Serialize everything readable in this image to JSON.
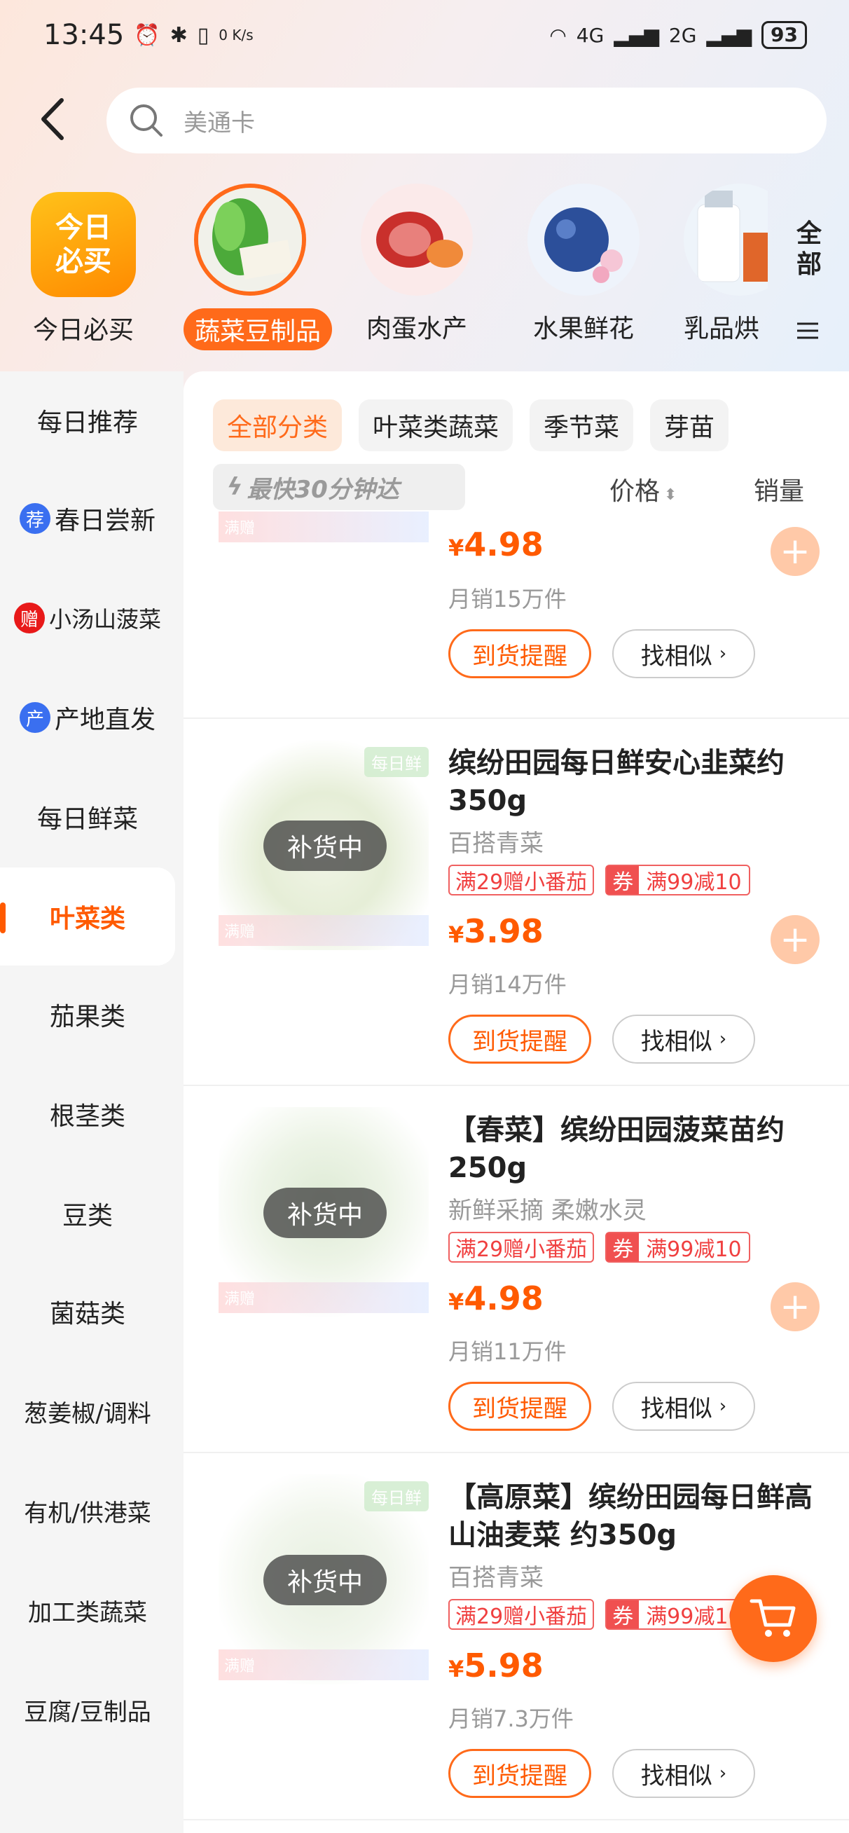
{
  "status_bar": {
    "time": "13:45",
    "net_speed": "0 K/s",
    "signal1": "4G",
    "signal2": "2G",
    "battery": "93"
  },
  "search": {
    "placeholder": "美通卡"
  },
  "top_categories": [
    {
      "label": "今日必买",
      "icon_text": "今日必买"
    },
    {
      "label": "蔬菜豆制品"
    },
    {
      "label": "肉蛋水产"
    },
    {
      "label": "水果鲜花"
    },
    {
      "label": "乳品烘"
    }
  ],
  "all_categories_label": "全部",
  "sidebar": {
    "items": [
      {
        "label": "每日推荐"
      },
      {
        "label": "春日尝新",
        "badge": "荐",
        "badge_color": "#3a6ff0"
      },
      {
        "label": "小汤山菠菜",
        "badge": "赠",
        "badge_color": "#e81919"
      },
      {
        "label": "产地直发",
        "badge": "产",
        "badge_color": "#3a6ff0"
      },
      {
        "label": "每日鲜菜"
      },
      {
        "label": "叶菜类"
      },
      {
        "label": "茄果类"
      },
      {
        "label": "根茎类"
      },
      {
        "label": "豆类"
      },
      {
        "label": "菌菇类"
      },
      {
        "label": "葱姜椒/调料"
      },
      {
        "label": "有机/供港菜"
      },
      {
        "label": "加工类蔬菜"
      },
      {
        "label": "豆腐/豆制品"
      }
    ]
  },
  "chips": [
    "全部分类",
    "叶菜类蔬菜",
    "季节菜",
    "芽苗"
  ],
  "sort": {
    "fast_label": "最快30分钟达",
    "price_label": "价格",
    "sales_label": "销量"
  },
  "products": [
    {
      "price": "4.98",
      "sales": "月销15万件",
      "remind": "到货提醒",
      "similar": "找相似",
      "gift_strip": "满赠"
    },
    {
      "name": "缤纷田园每日鲜安心韭菜约350g",
      "sub": "百搭青菜",
      "tag1": "满29赠小番茄",
      "coupon_mark": "券",
      "tag2": "满99减10",
      "price": "3.98",
      "sales": "月销14万件",
      "restock": "补货中",
      "remind": "到货提醒",
      "similar": "找相似",
      "fresh_tag": "每日鲜",
      "gift_strip": "满赠"
    },
    {
      "name": "【春菜】缤纷田园菠菜苗约250g",
      "sub": "新鲜采摘 柔嫩水灵",
      "tag1": "满29赠小番茄",
      "coupon_mark": "券",
      "tag2": "满99减10",
      "price": "4.98",
      "sales": "月销11万件",
      "restock": "补货中",
      "remind": "到货提醒",
      "similar": "找相似",
      "gift_strip": "满赠"
    },
    {
      "name": "【高原菜】缤纷田园每日鲜高山油麦菜 约350g",
      "sub": "百搭青菜",
      "tag1": "满29赠小番茄",
      "coupon_mark": "券",
      "tag2": "满99减10",
      "price": "5.98",
      "sales": "月销7.3万件",
      "restock": "补货中",
      "remind": "到货提醒",
      "similar": "找相似",
      "fresh_tag": "每日鲜",
      "gift_strip": "满赠"
    }
  ],
  "currency_symbol": "¥",
  "colors": {
    "accent": "#ff6a1a",
    "price": "#ff5a00",
    "tag_red": "#f04040"
  }
}
